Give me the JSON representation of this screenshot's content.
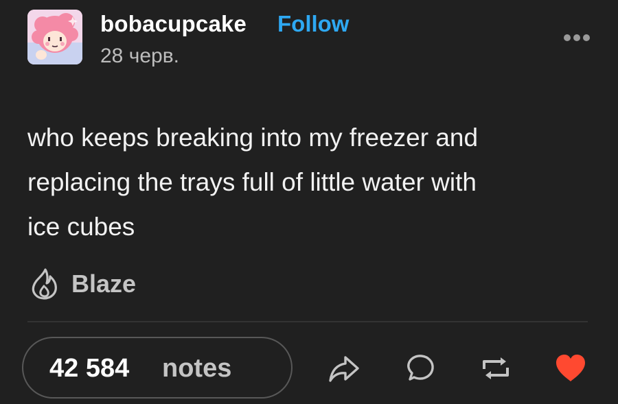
{
  "post": {
    "blog_name": "bobacupcake",
    "follow_label": "Follow",
    "date": "28 черв.",
    "body_lines": [
      "who keeps breaking into my freezer and",
      "replacing the trays full of little water with",
      "ice cubes"
    ],
    "blaze_label": "Blaze",
    "notes_count": "42 584",
    "notes_label": "notes",
    "liked": true
  },
  "colors": {
    "background": "#202020",
    "follow": "#2ea8f2",
    "like": "#ff4930",
    "muted_text": "#c4c4c4"
  },
  "icons": {
    "more": "ellipsis-icon",
    "blaze": "flame-icon",
    "share": "share-arrow-icon",
    "reply": "speech-bubble-icon",
    "reblog": "reblog-icon",
    "like": "heart-icon"
  }
}
